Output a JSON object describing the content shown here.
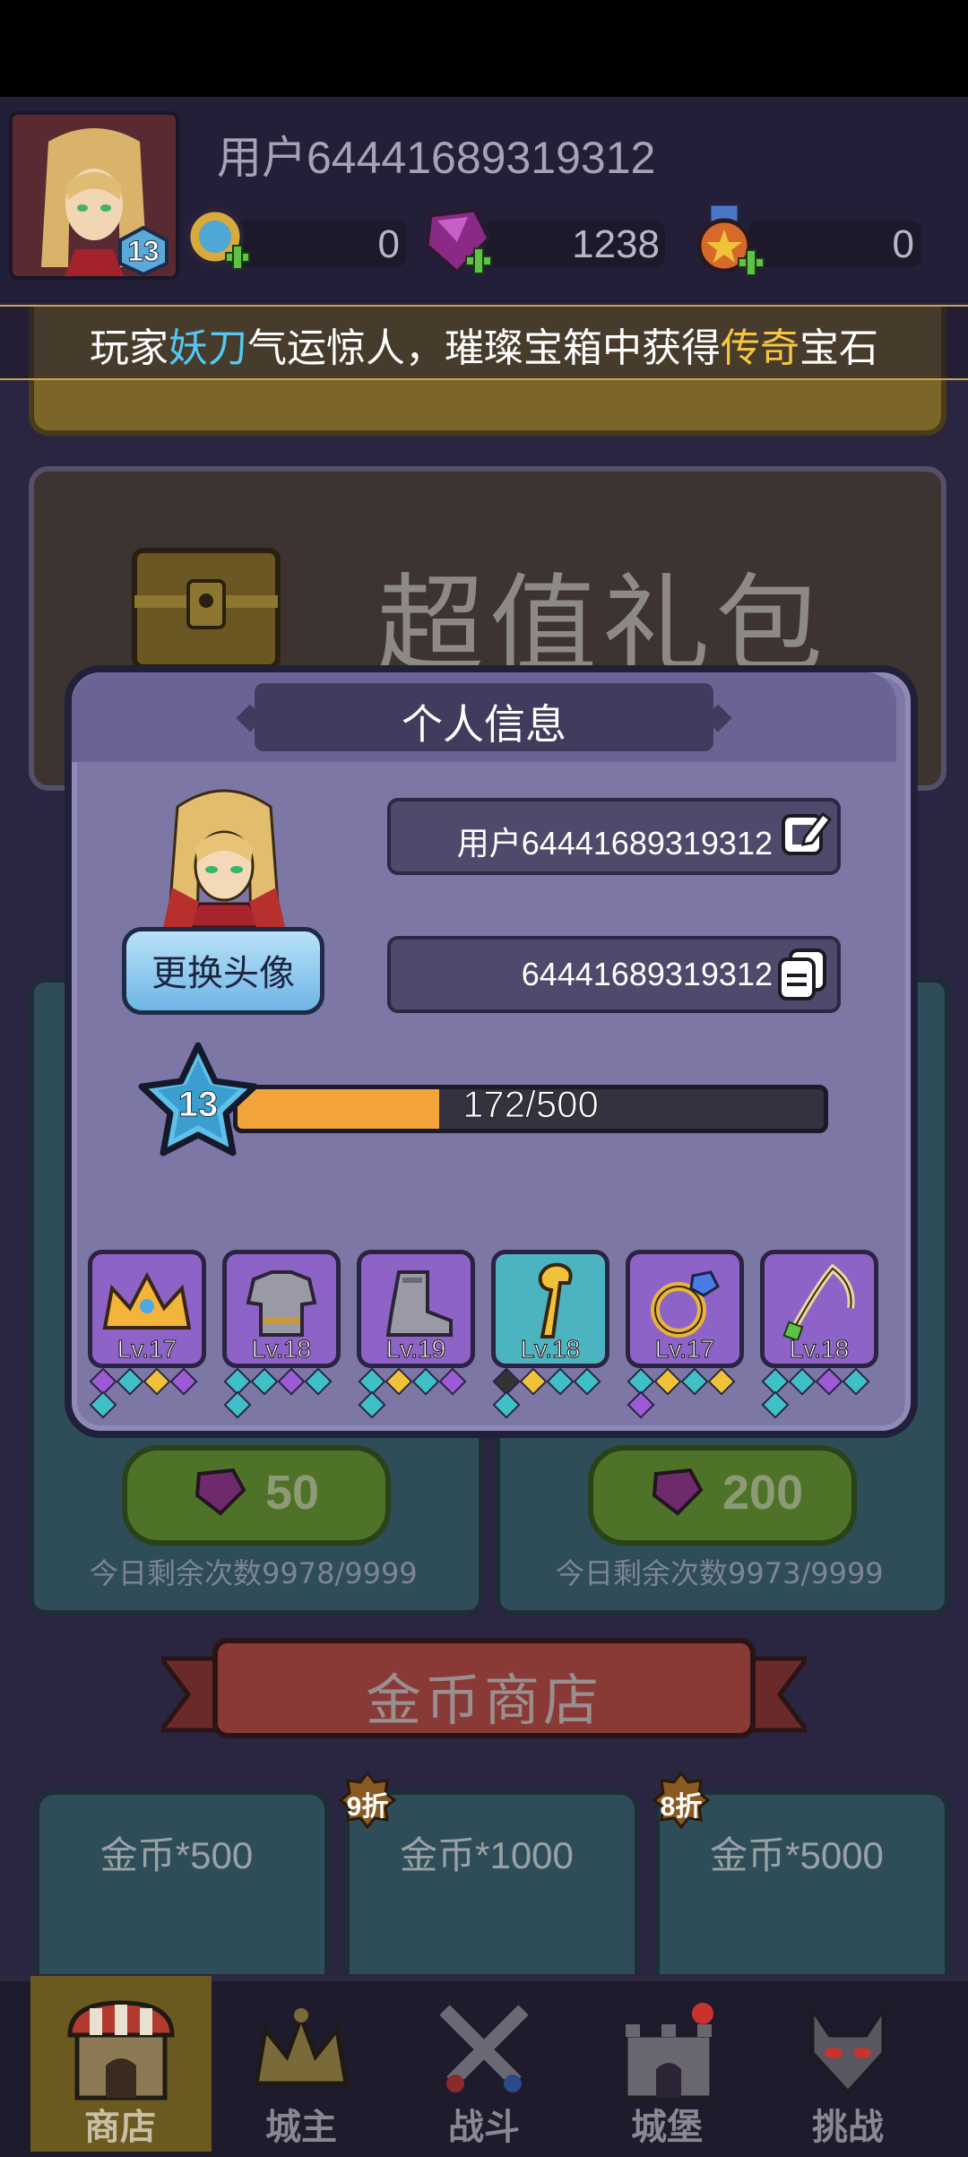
{
  "header": {
    "username": "用户64441689319312",
    "level": "13",
    "currencies": [
      {
        "icon": "coin-plus-icon",
        "value": "0"
      },
      {
        "icon": "gem-plus-icon",
        "value": "1238"
      },
      {
        "icon": "medal-plus-icon",
        "value": "0"
      }
    ]
  },
  "ticker": {
    "part1": "玩家",
    "name": "妖刀",
    "part2": "气运惊人，璀璨宝箱中获得",
    "item": "传奇",
    "part3": "宝石",
    "name_color": "#52c8f4",
    "item_color": "#f6c542"
  },
  "background": {
    "banner_title": "超值礼包",
    "cards": [
      {
        "price": "50",
        "remaining": "今日剩余次数9978/9999"
      },
      {
        "price": "200",
        "remaining": "今日剩余次数9973/9999"
      }
    ],
    "shop_title": "金币商店",
    "coin_items": [
      {
        "label": "金币*500",
        "discount": ""
      },
      {
        "label": "金币*1000",
        "discount": "9折"
      },
      {
        "label": "金币*5000",
        "discount": "8折"
      }
    ]
  },
  "nav": {
    "items": [
      {
        "label": "商店",
        "icon": "shop-icon",
        "active": true
      },
      {
        "label": "城主",
        "icon": "crown-icon",
        "active": false
      },
      {
        "label": "战斗",
        "icon": "crossed-swords-icon",
        "active": false
      },
      {
        "label": "城堡",
        "icon": "castle-icon",
        "active": false
      },
      {
        "label": "挑战",
        "icon": "demon-icon",
        "active": false
      }
    ]
  },
  "modal": {
    "title": "个人信息",
    "change_avatar_label": "更换头像",
    "name_field": "用户64441689319312",
    "id_field": "64441689319312",
    "level": "13",
    "xp_text": "172/500",
    "xp_fraction": 0.344,
    "equipment": [
      {
        "icon": "crown-icon",
        "level": "Lv.17",
        "gems": [
          "#9c5ad6",
          "#3fc0c8",
          "#f0c23a",
          "#9c5ad6",
          "#3fc0c8"
        ]
      },
      {
        "icon": "armor-icon",
        "level": "Lv.18",
        "gems": [
          "#3fc0c8",
          "#3fc0c8",
          "#9c5ad6",
          "#3fc0c8",
          "#3fc0c8"
        ]
      },
      {
        "icon": "boot-icon",
        "level": "Lv.19",
        "gems": [
          "#3fc0c8",
          "#f0c23a",
          "#3fc0c8",
          "#9c5ad6",
          "#3fc0c8"
        ]
      },
      {
        "icon": "staff-icon",
        "level": "Lv.18",
        "gems": [
          "#333",
          "#f0c23a",
          "#3fc0c8",
          "#3fc0c8",
          "#3fc0c8"
        ]
      },
      {
        "icon": "ring-icon",
        "level": "Lv.17",
        "gems": [
          "#3fc0c8",
          "#f0c23a",
          "#3fc0c8",
          "#f0c23a",
          "#9c5ad6"
        ]
      },
      {
        "icon": "bow-icon",
        "level": "Lv.18",
        "gems": [
          "#3fc0c8",
          "#3fc0c8",
          "#9c5ad6",
          "#3fc0c8",
          "#3fc0c8"
        ]
      }
    ]
  }
}
